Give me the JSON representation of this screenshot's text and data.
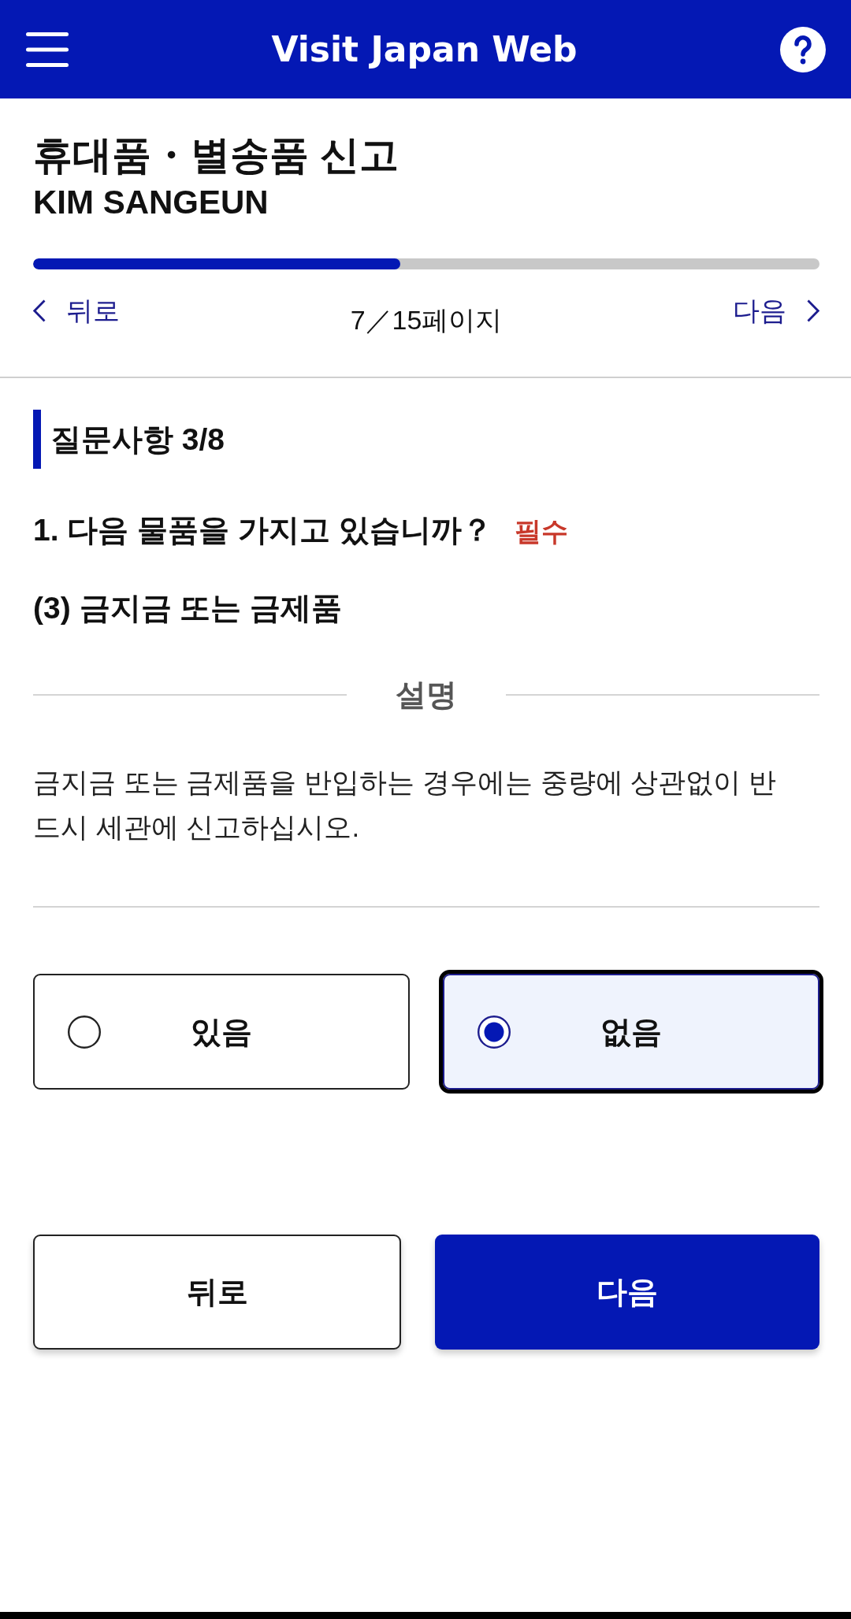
{
  "header": {
    "title": "Visit Japan Web"
  },
  "form": {
    "title": "휴대품・별송품 신고",
    "traveler": "KIM SANGEUN"
  },
  "progress": {
    "level": 0.467,
    "back": "뒤로",
    "page": "7／15페이지",
    "next": "다음"
  },
  "section": {
    "heading": "질문사항 3/8"
  },
  "question": {
    "text": "1. 다음 물품을 가지고 있습니까？",
    "required": "필수",
    "item": "(3) 금지금 또는 금제품"
  },
  "explanation": {
    "heading": "설명",
    "text": "금지금 또는 금제품을 반입하는 경우에는 중량에 상관없이 반드시 세관에 신고하십시오."
  },
  "options": [
    {
      "label": "있음",
      "selected": false
    },
    {
      "label": "없음",
      "selected": true
    }
  ],
  "buttons": [
    {
      "label": "뒤로",
      "kind": "secondary"
    },
    {
      "label": "다음",
      "kind": "primary"
    }
  ]
}
